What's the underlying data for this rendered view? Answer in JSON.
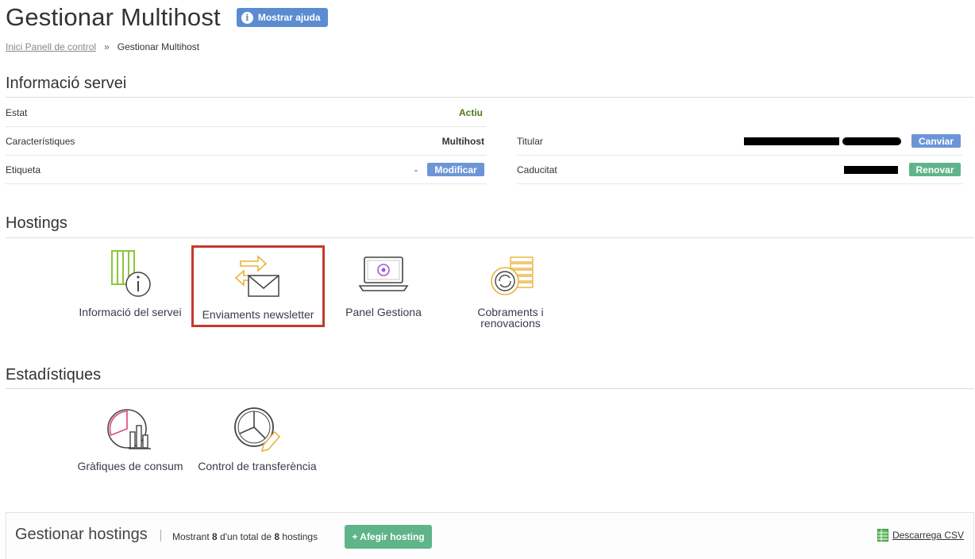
{
  "header": {
    "title": "Gestionar Multihost",
    "help_label": "Mostrar ajuda"
  },
  "breadcrumb": {
    "home": "Inici Panell de control",
    "separator": "»",
    "current": "Gestionar Multihost"
  },
  "service_info": {
    "title": "Informació servei",
    "left": [
      {
        "label": "Estat",
        "value": "Actiu"
      },
      {
        "label": "Característiques",
        "value": "Multihost"
      },
      {
        "label": "Etiqueta",
        "value": "-",
        "button": "Modificar"
      }
    ],
    "right": [
      {
        "label": "Titular",
        "button": "Canviar"
      },
      {
        "label": "Caducitat",
        "button": "Renovar"
      }
    ]
  },
  "hostings": {
    "title": "Hostings",
    "tiles": [
      {
        "label": "Informació del servei",
        "icon": "server-info-icon"
      },
      {
        "label": "Enviaments newsletter",
        "icon": "newsletter-mail-icon"
      },
      {
        "label": "Panel Gestiona",
        "icon": "laptop-panel-icon"
      },
      {
        "label": "Cobraments i renovacions",
        "icon": "billing-renewal-icon"
      }
    ]
  },
  "stats": {
    "title": "Estadístiques",
    "tiles": [
      {
        "label": "Gràfiques de consum",
        "icon": "consumption-chart-icon"
      },
      {
        "label": "Control de transferència",
        "icon": "transfer-pie-icon"
      }
    ]
  },
  "manage": {
    "title": "Gestionar hostings",
    "count_prefix": "Mostrant ",
    "shown": "8",
    "count_middle": " d'un total de ",
    "total": "8",
    "count_suffix": " hostings",
    "add_label": "+ Afegir hosting",
    "csv_label": "Descarrega CSV"
  },
  "colors": {
    "blue_button": "#6d95d6",
    "green_button": "#5fb48a",
    "status_green": "#4b7a1f",
    "selection_border": "#c53a2c"
  }
}
